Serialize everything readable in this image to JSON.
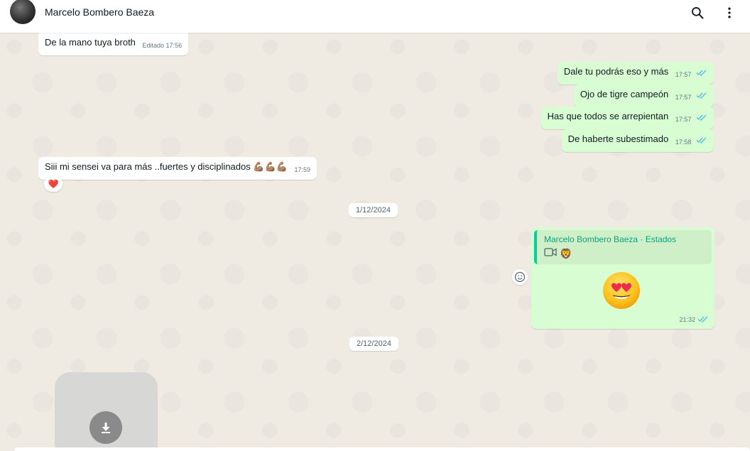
{
  "header": {
    "contact_name": "Marcelo Bombero Baeza",
    "search_icon": "search-icon",
    "menu_icon": "more-vertical-icon"
  },
  "messages": [
    {
      "direction": "in",
      "text": "De la mano tuya broth",
      "meta": "Editado 17:56"
    },
    {
      "direction": "out",
      "text": "Dale tu podrás eso y más",
      "time": "17:57",
      "status": "read"
    },
    {
      "direction": "out",
      "text": "Ojo de tigre campeón",
      "time": "17:57",
      "status": "read"
    },
    {
      "direction": "out",
      "text": "Has que todos se arrepientan",
      "time": "17:57",
      "status": "read"
    },
    {
      "direction": "out",
      "text": "De haberte subestimado",
      "time": "17:58",
      "status": "read"
    },
    {
      "direction": "in",
      "text": "Siii mi sensei va para más ..fuertes y disciplinados 💪🏽💪🏽💪🏽",
      "time": "17:59",
      "reaction": "❤️"
    }
  ],
  "dates": [
    "1/12/2024",
    "2/12/2024"
  ],
  "status_reply": {
    "quote_title": "Marcelo Bombero Baeza · Estados",
    "quote_icons": "🦁",
    "emoji": "heart-eyes-emoji",
    "time": "21:32",
    "status": "read"
  },
  "media": {
    "download_icon": "download-arrow-icon"
  },
  "colors": {
    "outgoing": "#d9fdd3",
    "incoming": "#ffffff",
    "tick_read": "#53bdeb",
    "quote_accent": "#06cf9c",
    "background": "#efeae2"
  }
}
